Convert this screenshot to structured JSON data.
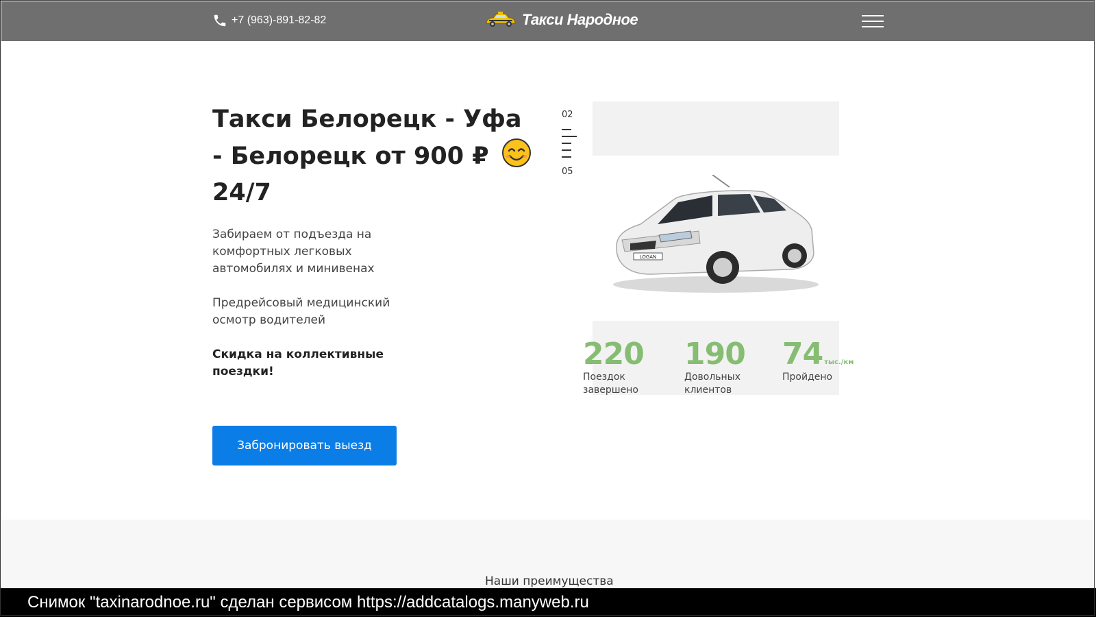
{
  "header": {
    "phone": "+7 (963)-891-82-82",
    "phone_icon": "phone-icon",
    "logo_text": "Такси Народное",
    "logo_icon": "taxi-car-icon",
    "menu_icon": "hamburger-menu-icon"
  },
  "hero": {
    "title": "Такси Белорецк - Уфа - Белорецк от 900 ₽",
    "title_tail": "24/7",
    "emoji_icon": "smiling-face-icon",
    "desc1": "Забираем от подъезда на комфортных легковых автомобилях и минивенах",
    "desc2": "Предрейсовый медицинский осмотр водителей",
    "desc3": "Скидка на коллективные поездки!",
    "button": "Забронировать выезд"
  },
  "slider": {
    "current": "02",
    "total": "05",
    "image_icon": "white-sedan-car-image"
  },
  "stats": [
    {
      "value": "220",
      "unit": "",
      "label": "Поездок завершено"
    },
    {
      "value": "190",
      "unit": "",
      "label": "Довольных клиентов"
    },
    {
      "value": "74",
      "unit": "тыс./км",
      "label": "Пройдено"
    }
  ],
  "section2": {
    "title": "Наши преимущества"
  },
  "caption": "Снимок \"taxinarodnoe.ru\" сделан сервисом https://addcatalogs.manyweb.ru",
  "colors": {
    "header_bg": "#6f6f6f",
    "button": "#0b7de6",
    "stat_green": "#86bd72"
  }
}
